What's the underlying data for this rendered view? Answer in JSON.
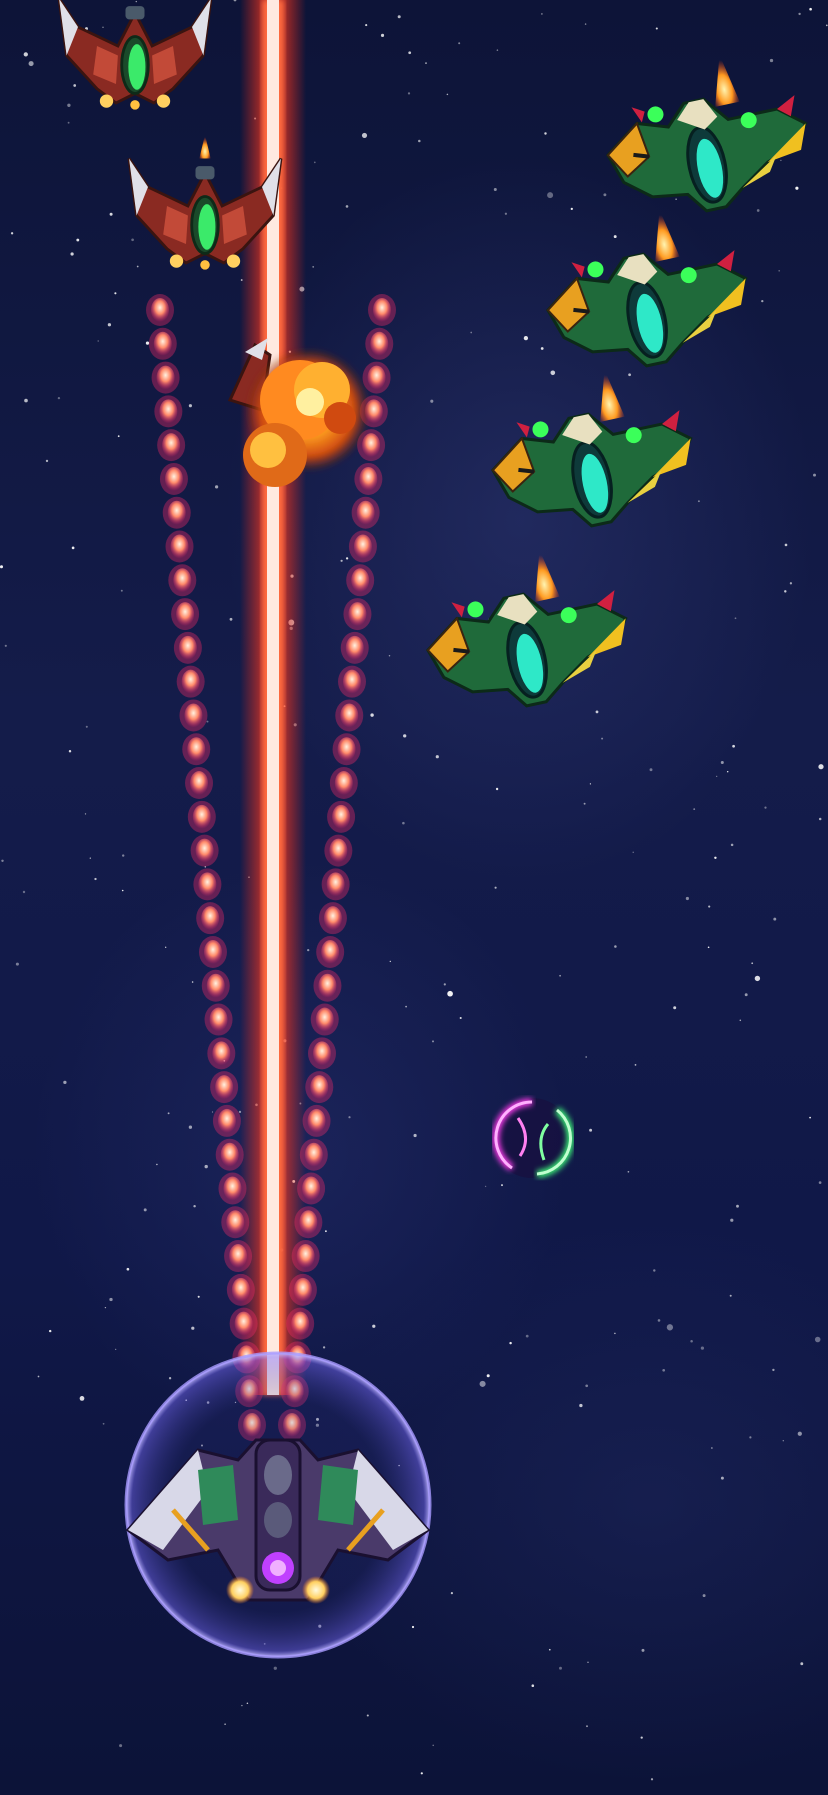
{
  "game": {
    "name": "space-shooter",
    "colors": {
      "space": "#0b1233",
      "laser_core": "#ffe9e0",
      "laser_glow": "#ff3a1e",
      "bullet": "#ff7a7a",
      "shield": "#8a7cff",
      "powerup_pink": "#ff3df0",
      "powerup_green": "#3dff7a",
      "enemy_red": "#b83a2e",
      "enemy_green": "#2fd17a"
    },
    "icons": {
      "player": "player-ship-icon",
      "enemy_red": "red-fighter-icon",
      "enemy_green": "green-fighter-icon",
      "explosion": "explosion-icon",
      "powerup": "energy-orb-icon"
    }
  }
}
